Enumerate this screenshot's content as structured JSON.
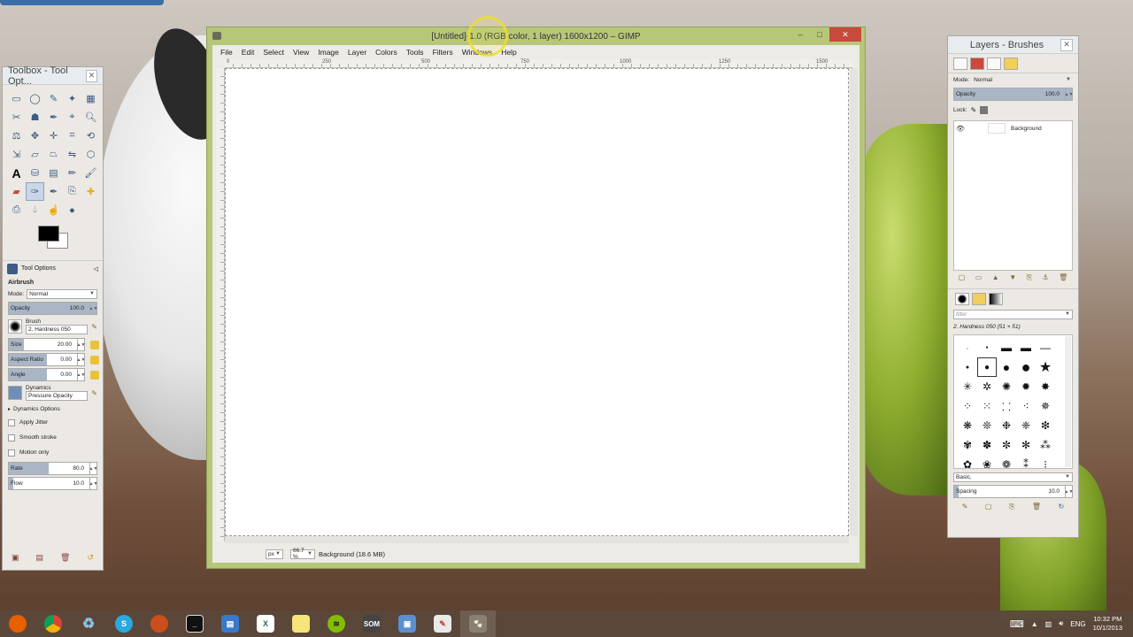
{
  "main_window": {
    "title": "[Untitled]-1.0 (RGB color, 1 layer) 1600x1200 – GIMP",
    "menu": [
      "File",
      "Edit",
      "Select",
      "View",
      "Image",
      "Layer",
      "Colors",
      "Tools",
      "Filters",
      "Windows",
      "Help"
    ],
    "ruler_labels": [
      "0",
      "250",
      "500",
      "750",
      "1000",
      "1250",
      "1500"
    ],
    "status": {
      "unit": "px",
      "zoom": "66.7 %",
      "layer_info": "Background (18.6 MB)"
    },
    "controls": {
      "minimize": "–",
      "maximize": "□",
      "close": "✕"
    }
  },
  "toolbox": {
    "title": "Toolbox - Tool Opt...",
    "close": "◁",
    "tab_label": "Tool Options",
    "tool_name": "Airbrush",
    "mode_label": "Mode:",
    "mode_value": "Normal",
    "opacity_label": "Opacity",
    "opacity_value": "100.0",
    "brush_label": "Brush",
    "brush_value": "2. Hardness 050",
    "size_label": "Size",
    "size_value": "20.00",
    "aspect_label": "Aspect Ratio",
    "aspect_value": "0.00",
    "angle_label": "Angle",
    "angle_value": "0.00",
    "dynamics_label": "Dynamics",
    "dynamics_value": "Pressure Opacity",
    "dynamics_options": "Dynamics Options",
    "apply_jitter": "Apply Jitter",
    "smooth_stroke": "Smooth stroke",
    "motion_only": "Motion only",
    "rate_label": "Rate",
    "rate_value": "80.0",
    "flow_label": "Flow",
    "flow_value": "10.0"
  },
  "layers_panel": {
    "title": "Layers - Brushes",
    "mode_label": "Mode:",
    "mode_value": "Normal",
    "opacity_label": "Opacity",
    "opacity_value": "100.0",
    "lock_label": "Lock:",
    "layer_name": "Background",
    "filter_placeholder": "filter",
    "brush_selected": "2. Hardness 050 (51 × 51)",
    "brush_tag": "Basic,",
    "spacing_label": "Spacing",
    "spacing_value": "10.0"
  },
  "taskbar": {
    "apps": [
      "firefox",
      "chrome",
      "recycle",
      "skype",
      "firefox-dev",
      "terminal",
      "explorer",
      "excel",
      "sticky-notes",
      "spotify",
      "som",
      "remote",
      "paint",
      "gimp"
    ],
    "language": "ENG",
    "time": "10:32 PM",
    "date": "10/1/2013"
  },
  "colors": {
    "window_frame": "#b7c77a",
    "close_button": "#c74a3c",
    "panel_bg": "#ece9e4",
    "accent": "#3d5c86"
  }
}
